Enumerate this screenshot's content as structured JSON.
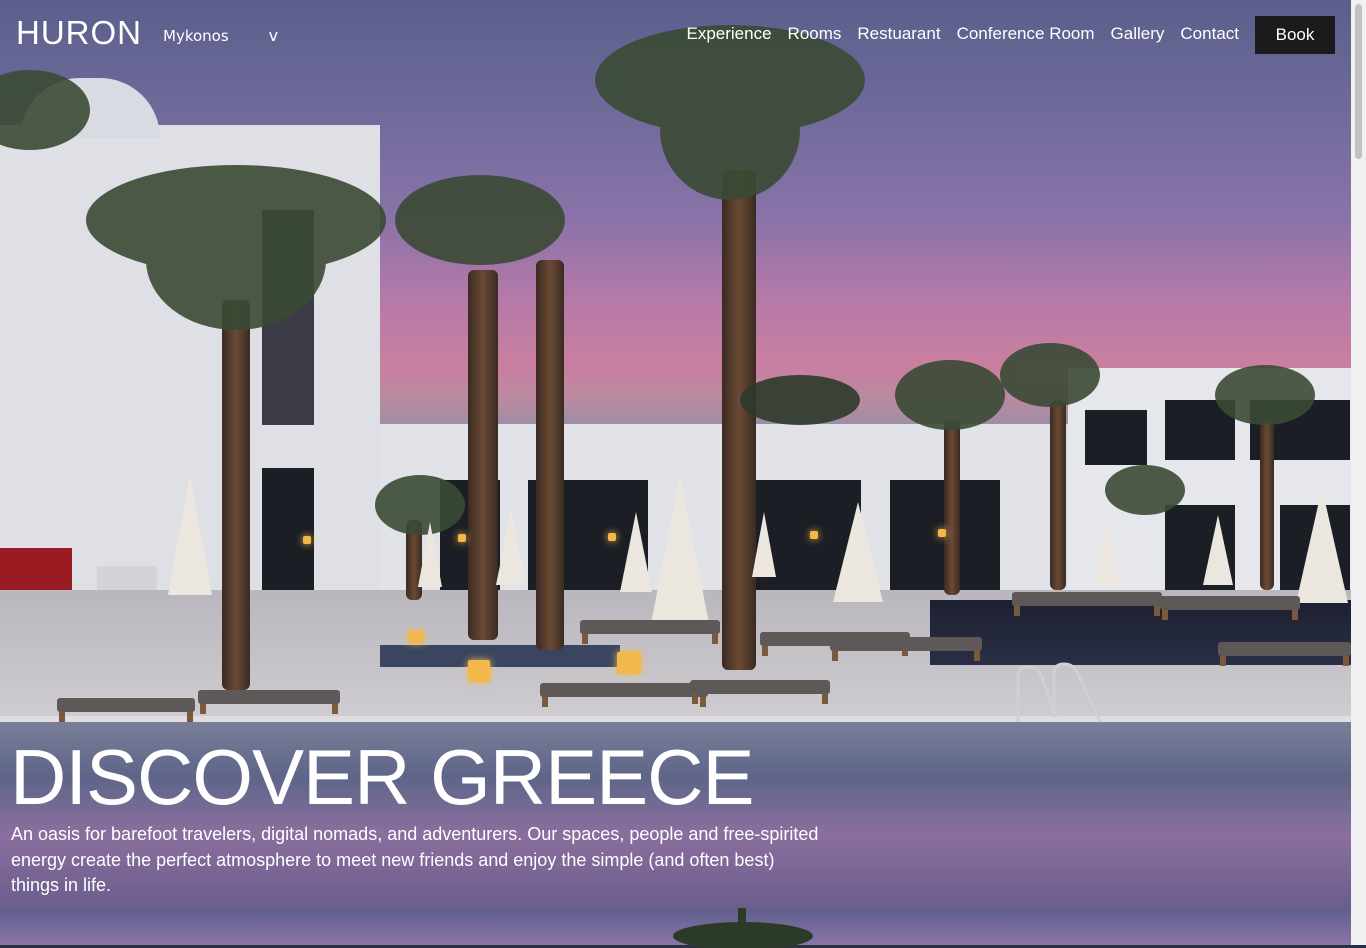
{
  "brand": {
    "logo": "HURON"
  },
  "location_select": {
    "value": "Mykonos",
    "chevron": "v"
  },
  "nav": {
    "items": [
      {
        "label": "Experience"
      },
      {
        "label": "Rooms"
      },
      {
        "label": "Restuarant"
      },
      {
        "label": "Conference Room"
      },
      {
        "label": "Gallery"
      },
      {
        "label": "Contact"
      }
    ],
    "book_label": "Book"
  },
  "hero": {
    "headline": "DISCOVER GREECE",
    "description": "An oasis for barefoot travelers, digital nomads, and adventurers. Our spaces, people and free-spirited energy create the perfect atmosphere to meet new friends and enjoy the simple (and often best) things in life."
  },
  "colors": {
    "book_bg": "#1b1b1d",
    "text": "#ffffff"
  }
}
